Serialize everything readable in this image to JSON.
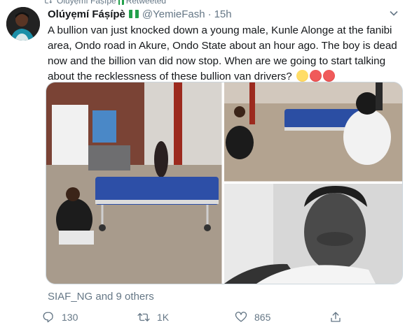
{
  "retweet": {
    "text": "Olúyẹmí Fáṣípè",
    "suffix": "Retweeted"
  },
  "author": {
    "display_name": "Olúyẹmí Fáṣípè",
    "handle": "@YemieFash",
    "separator": "·",
    "time": "15h",
    "flag": "nigeria-flag"
  },
  "tweet": {
    "text": "A bullion van just knocked down a young male, Kunle Alonge at the fanibi area, Ondo road in Akure, Ondo State about an hour ago. The boy is dead now and the billion van did now stop. When are we going to start talking about the recklessness of these bullion van drivers?",
    "emojis": [
      "confused-face",
      "angry-face",
      "angry-face"
    ]
  },
  "media": {
    "images": [
      "accident-scene-stretcher-wide",
      "accident-scene-stretcher-crowd",
      "portrait-young-man"
    ]
  },
  "likers_text": "SIAF_NG and 9 others",
  "actions": {
    "reply": {
      "icon": "reply-icon",
      "count": "130"
    },
    "retweet": {
      "icon": "retweet-icon",
      "count": "1K"
    },
    "like": {
      "icon": "heart-icon",
      "count": "865"
    },
    "share": {
      "icon": "share-icon"
    }
  },
  "colors": {
    "accent": "#1da1f2",
    "muted": "#657786",
    "text": "#14171a",
    "border": "#ccd6dd"
  }
}
